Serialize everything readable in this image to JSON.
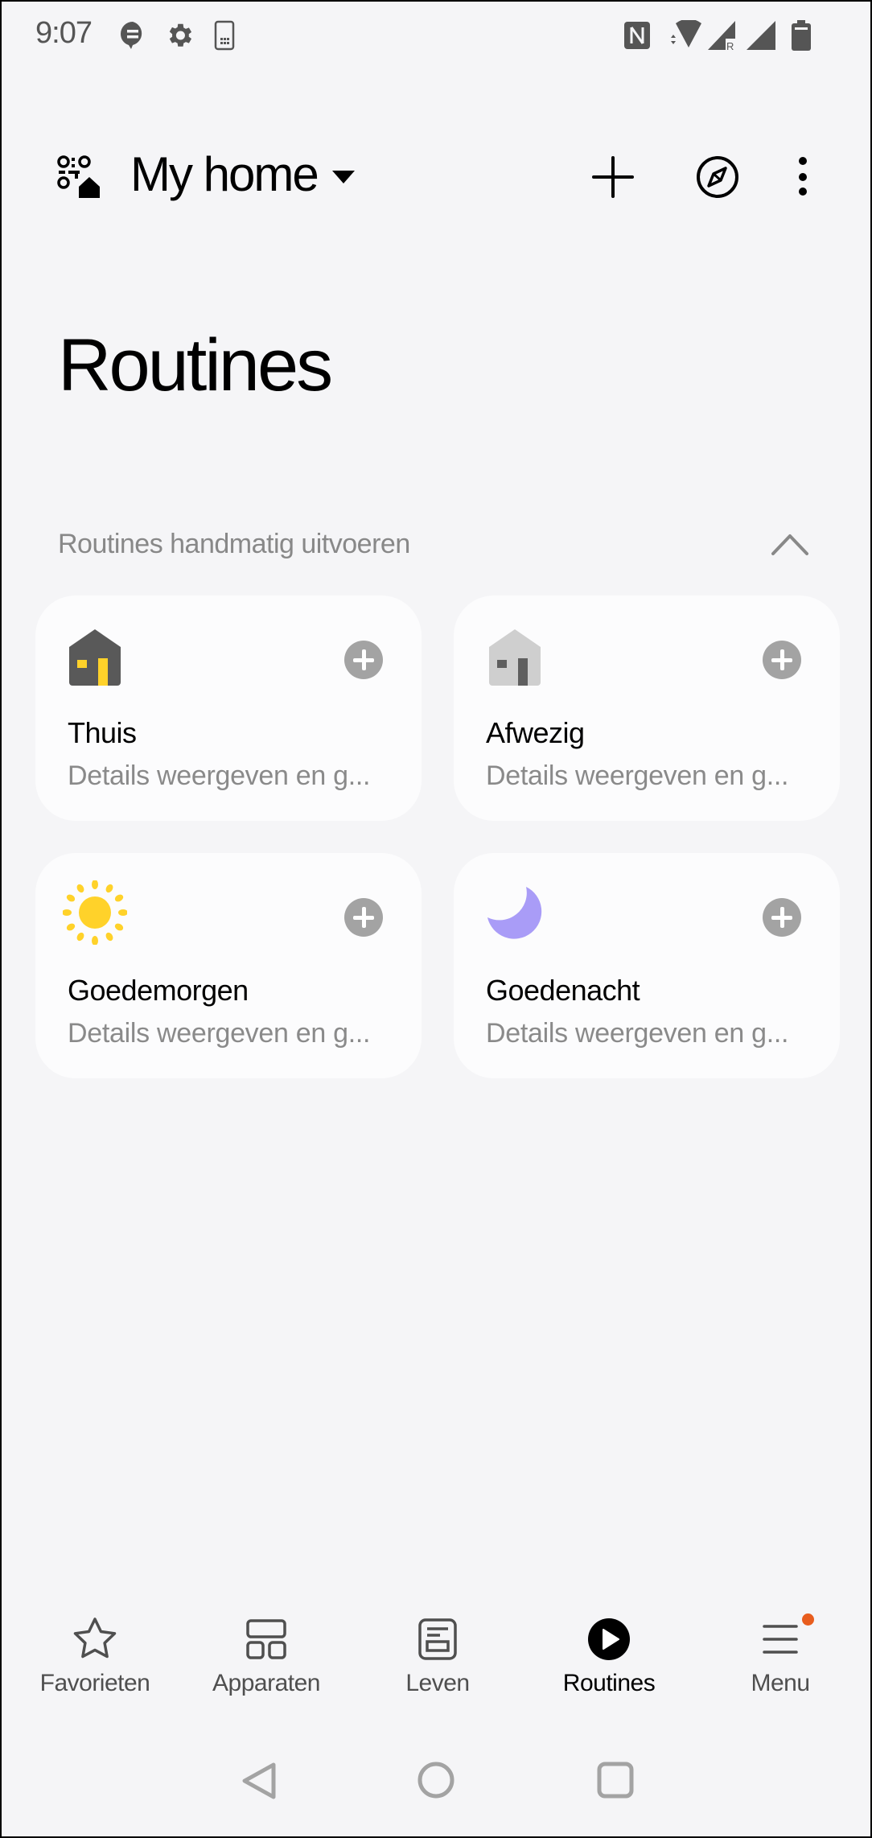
{
  "status_bar": {
    "time": "9:07",
    "left_icons": [
      "message-notification-icon",
      "settings-icon",
      "sim-card-icon"
    ],
    "right_icons": [
      "nfc-icon",
      "wifi-icon",
      "signal-roaming-icon",
      "signal-icon",
      "battery-icon"
    ]
  },
  "header": {
    "home_name": "My home",
    "actions": [
      "add-icon",
      "discover-icon",
      "more-icon"
    ]
  },
  "page": {
    "title": "Routines",
    "section_label": "Routines handmatig uitvoeren",
    "section_expanded": true
  },
  "routines": [
    {
      "name": "Thuis",
      "description": "Details weergeven en g...",
      "icon": "home-icon"
    },
    {
      "name": "Afwezig",
      "description": "Details weergeven en g...",
      "icon": "away-home-icon"
    },
    {
      "name": "Goedemorgen",
      "description": "Details weergeven en g...",
      "icon": "sun-icon"
    },
    {
      "name": "Goedenacht",
      "description": "Details weergeven en g...",
      "icon": "moon-icon"
    }
  ],
  "bottom_nav": {
    "items": [
      {
        "label": "Favorieten",
        "icon": "star-icon",
        "active": false
      },
      {
        "label": "Apparaten",
        "icon": "devices-icon",
        "active": false
      },
      {
        "label": "Leven",
        "icon": "life-icon",
        "active": false
      },
      {
        "label": "Routines",
        "icon": "routines-play-icon",
        "active": true
      },
      {
        "label": "Menu",
        "icon": "menu-icon",
        "active": false,
        "badge": true
      }
    ]
  },
  "colors": {
    "background": "#f5f5f7",
    "card": "#fcfcfd",
    "sun_yellow": "#ffd22a",
    "moon_purple": "#a99cf7",
    "badge_orange": "#e85d1e",
    "add_gray": "#a3a3a3"
  }
}
